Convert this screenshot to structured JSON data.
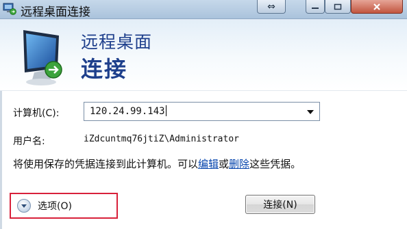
{
  "window": {
    "title": "远程桌面连接",
    "controls": {
      "swap": "⇔",
      "minimize": "",
      "maximize": "",
      "close": ""
    }
  },
  "banner": {
    "line1": "远程桌面",
    "line2": "连接"
  },
  "form": {
    "computer_label": "计算机(C):",
    "computer_value": "120.24.99.143",
    "username_label": "用户名:",
    "username_value": "iZdcuntmq76jtiZ\\Administrator"
  },
  "note": {
    "text_before": "将使用保存的凭据连接到此计算机。可以",
    "edit_link": "编辑",
    "text_mid": "或",
    "delete_link": "删除",
    "text_after": "这些凭据。"
  },
  "footer": {
    "options_label": "选项(O)",
    "connect_label": "连接(N)"
  },
  "colors": {
    "banner_text": "#1e3f8c",
    "highlight_box": "#d8203a",
    "link": "#0645ad"
  }
}
